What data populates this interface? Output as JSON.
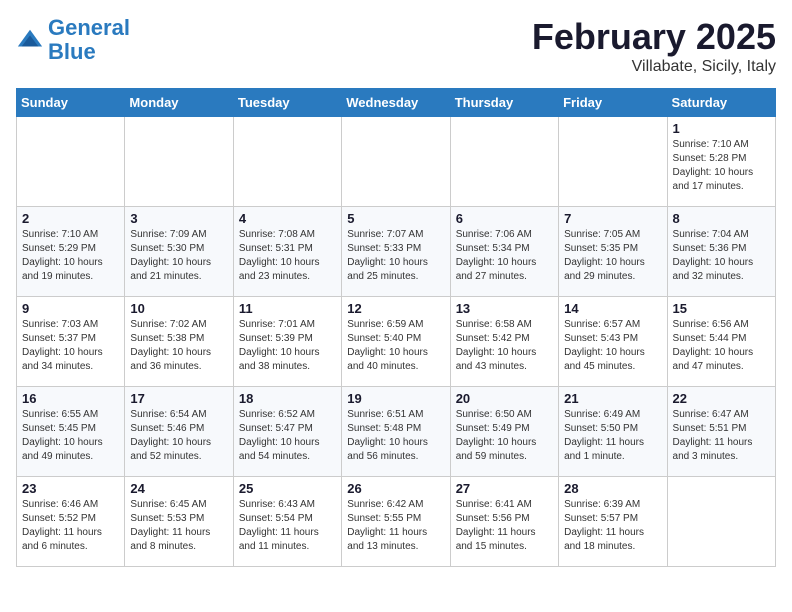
{
  "header": {
    "logo_line1": "General",
    "logo_line2": "Blue",
    "title": "February 2025",
    "subtitle": "Villabate, Sicily, Italy"
  },
  "days_of_week": [
    "Sunday",
    "Monday",
    "Tuesday",
    "Wednesday",
    "Thursday",
    "Friday",
    "Saturday"
  ],
  "weeks": [
    [
      {
        "day": "",
        "info": ""
      },
      {
        "day": "",
        "info": ""
      },
      {
        "day": "",
        "info": ""
      },
      {
        "day": "",
        "info": ""
      },
      {
        "day": "",
        "info": ""
      },
      {
        "day": "",
        "info": ""
      },
      {
        "day": "1",
        "info": "Sunrise: 7:10 AM\nSunset: 5:28 PM\nDaylight: 10 hours\nand 17 minutes."
      }
    ],
    [
      {
        "day": "2",
        "info": "Sunrise: 7:10 AM\nSunset: 5:29 PM\nDaylight: 10 hours\nand 19 minutes."
      },
      {
        "day": "3",
        "info": "Sunrise: 7:09 AM\nSunset: 5:30 PM\nDaylight: 10 hours\nand 21 minutes."
      },
      {
        "day": "4",
        "info": "Sunrise: 7:08 AM\nSunset: 5:31 PM\nDaylight: 10 hours\nand 23 minutes."
      },
      {
        "day": "5",
        "info": "Sunrise: 7:07 AM\nSunset: 5:33 PM\nDaylight: 10 hours\nand 25 minutes."
      },
      {
        "day": "6",
        "info": "Sunrise: 7:06 AM\nSunset: 5:34 PM\nDaylight: 10 hours\nand 27 minutes."
      },
      {
        "day": "7",
        "info": "Sunrise: 7:05 AM\nSunset: 5:35 PM\nDaylight: 10 hours\nand 29 minutes."
      },
      {
        "day": "8",
        "info": "Sunrise: 7:04 AM\nSunset: 5:36 PM\nDaylight: 10 hours\nand 32 minutes."
      }
    ],
    [
      {
        "day": "9",
        "info": "Sunrise: 7:03 AM\nSunset: 5:37 PM\nDaylight: 10 hours\nand 34 minutes."
      },
      {
        "day": "10",
        "info": "Sunrise: 7:02 AM\nSunset: 5:38 PM\nDaylight: 10 hours\nand 36 minutes."
      },
      {
        "day": "11",
        "info": "Sunrise: 7:01 AM\nSunset: 5:39 PM\nDaylight: 10 hours\nand 38 minutes."
      },
      {
        "day": "12",
        "info": "Sunrise: 6:59 AM\nSunset: 5:40 PM\nDaylight: 10 hours\nand 40 minutes."
      },
      {
        "day": "13",
        "info": "Sunrise: 6:58 AM\nSunset: 5:42 PM\nDaylight: 10 hours\nand 43 minutes."
      },
      {
        "day": "14",
        "info": "Sunrise: 6:57 AM\nSunset: 5:43 PM\nDaylight: 10 hours\nand 45 minutes."
      },
      {
        "day": "15",
        "info": "Sunrise: 6:56 AM\nSunset: 5:44 PM\nDaylight: 10 hours\nand 47 minutes."
      }
    ],
    [
      {
        "day": "16",
        "info": "Sunrise: 6:55 AM\nSunset: 5:45 PM\nDaylight: 10 hours\nand 49 minutes."
      },
      {
        "day": "17",
        "info": "Sunrise: 6:54 AM\nSunset: 5:46 PM\nDaylight: 10 hours\nand 52 minutes."
      },
      {
        "day": "18",
        "info": "Sunrise: 6:52 AM\nSunset: 5:47 PM\nDaylight: 10 hours\nand 54 minutes."
      },
      {
        "day": "19",
        "info": "Sunrise: 6:51 AM\nSunset: 5:48 PM\nDaylight: 10 hours\nand 56 minutes."
      },
      {
        "day": "20",
        "info": "Sunrise: 6:50 AM\nSunset: 5:49 PM\nDaylight: 10 hours\nand 59 minutes."
      },
      {
        "day": "21",
        "info": "Sunrise: 6:49 AM\nSunset: 5:50 PM\nDaylight: 11 hours\nand 1 minute."
      },
      {
        "day": "22",
        "info": "Sunrise: 6:47 AM\nSunset: 5:51 PM\nDaylight: 11 hours\nand 3 minutes."
      }
    ],
    [
      {
        "day": "23",
        "info": "Sunrise: 6:46 AM\nSunset: 5:52 PM\nDaylight: 11 hours\nand 6 minutes."
      },
      {
        "day": "24",
        "info": "Sunrise: 6:45 AM\nSunset: 5:53 PM\nDaylight: 11 hours\nand 8 minutes."
      },
      {
        "day": "25",
        "info": "Sunrise: 6:43 AM\nSunset: 5:54 PM\nDaylight: 11 hours\nand 11 minutes."
      },
      {
        "day": "26",
        "info": "Sunrise: 6:42 AM\nSunset: 5:55 PM\nDaylight: 11 hours\nand 13 minutes."
      },
      {
        "day": "27",
        "info": "Sunrise: 6:41 AM\nSunset: 5:56 PM\nDaylight: 11 hours\nand 15 minutes."
      },
      {
        "day": "28",
        "info": "Sunrise: 6:39 AM\nSunset: 5:57 PM\nDaylight: 11 hours\nand 18 minutes."
      },
      {
        "day": "",
        "info": ""
      }
    ]
  ]
}
